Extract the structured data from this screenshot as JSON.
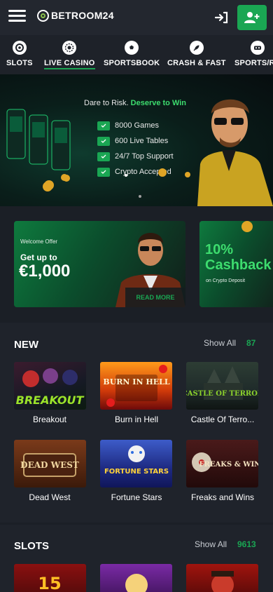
{
  "header": {
    "logo_text": "BETROOM24",
    "brand_color": "#1aa653",
    "hamburger_icon": "hamburger-icon",
    "login_icon": "login-icon",
    "signup_icon": "add-user-icon"
  },
  "nav": {
    "items": [
      {
        "label": "SLOTS",
        "icon": "slots-icon",
        "active": false
      },
      {
        "label": "LIVE CASINO",
        "icon": "live-casino-icon",
        "active": true
      },
      {
        "label": "SPORTSBOOK",
        "icon": "soccer-ball-icon",
        "active": false
      },
      {
        "label": "CRASH & FAST",
        "icon": "rocket-icon",
        "active": false
      },
      {
        "label": "SPORTS/RA",
        "icon": "vr-headset-icon",
        "active": false
      }
    ]
  },
  "hero": {
    "tagline_plain": "Dare to Risk. ",
    "tagline_highlight": "Deserve to Win",
    "features": [
      "8000 Games",
      "600 Live Tables",
      "24/7 Top Support",
      "Crypto Accepted"
    ]
  },
  "promos": [
    {
      "small": "Welcome Offer",
      "mid": "Get up to",
      "big": "€1,000",
      "button": "READ MORE"
    },
    {
      "big_1": "10%",
      "big_2": "Cashback",
      "sub": "on Crypto Deposit"
    }
  ],
  "sections": {
    "new": {
      "title": "NEW",
      "show_all": "Show All",
      "count": "87",
      "games": [
        {
          "name": "Breakout",
          "art": "BREAKOUT"
        },
        {
          "name": "Burn in Hell",
          "art": "BURN IN HELL"
        },
        {
          "name": "Castle Of Terro...",
          "art": "CASTLE OF TERROR"
        },
        {
          "name": "Dead West",
          "art": "DEAD WEST"
        },
        {
          "name": "Fortune Stars",
          "art": "FORTUNE STARS"
        },
        {
          "name": "Freaks and Wins",
          "art": "FREAKS & WINS"
        }
      ]
    },
    "slots": {
      "title": "SLOTS",
      "show_all": "Show All",
      "count": "9613",
      "games": [
        {
          "name": "",
          "art": "15"
        },
        {
          "name": "",
          "art": ""
        },
        {
          "name": "",
          "art": ""
        }
      ]
    }
  }
}
